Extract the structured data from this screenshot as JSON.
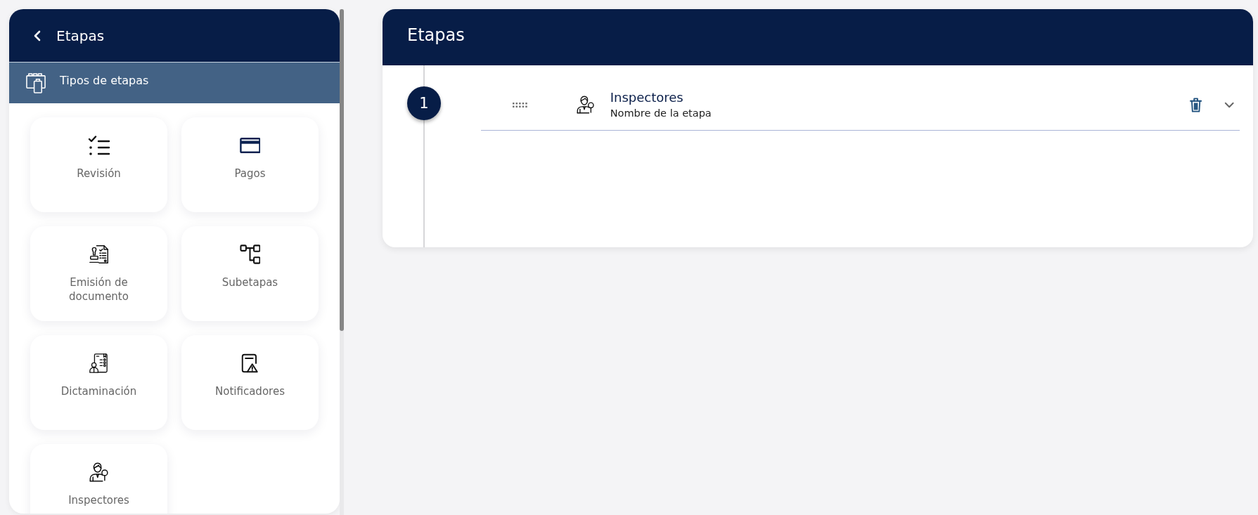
{
  "sidebar": {
    "title": "Etapas",
    "section": {
      "label": "Tipos de etapas"
    },
    "stage_types": [
      {
        "label": "Revisión",
        "kind": "checklist"
      },
      {
        "label": "Pagos",
        "kind": "card"
      },
      {
        "label": "Emisión de documento",
        "kind": "stamp"
      },
      {
        "label": "Subetapas",
        "kind": "hierarchy"
      },
      {
        "label": "Dictaminación",
        "kind": "report"
      },
      {
        "label": "Notificadores",
        "kind": "alert"
      },
      {
        "label": "Inspectores",
        "kind": "inspector"
      }
    ]
  },
  "main": {
    "title": "Etapas",
    "stages": [
      {
        "number": "1",
        "kind": "inspector",
        "title": "Inspectores",
        "subtitle": "Nombre de la etapa"
      }
    ]
  }
}
